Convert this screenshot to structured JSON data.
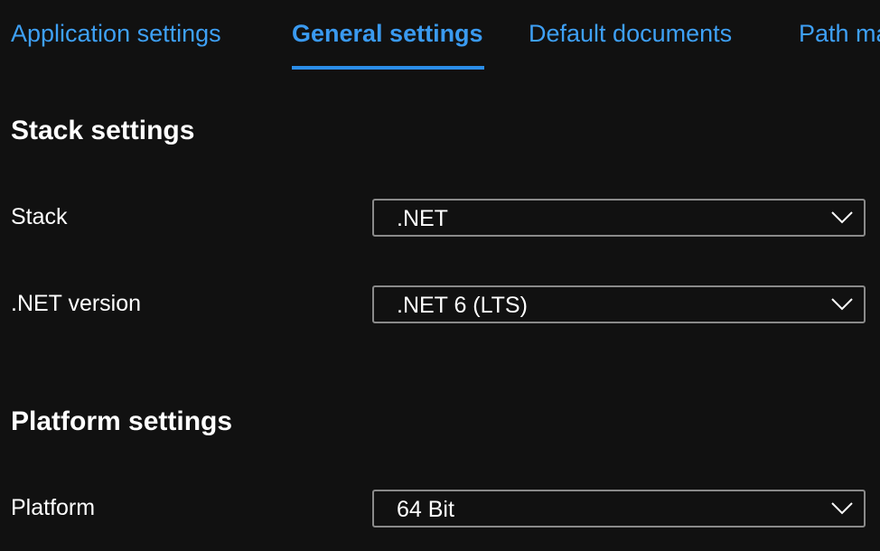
{
  "tabs": [
    {
      "label": "Application settings",
      "active": false
    },
    {
      "label": "General settings",
      "active": true
    },
    {
      "label": "Default documents",
      "active": false
    },
    {
      "label": "Path mappings",
      "active": false
    }
  ],
  "stack_settings": {
    "heading": "Stack settings",
    "stack": {
      "label": "Stack",
      "value": ".NET"
    },
    "net_version": {
      "label": ".NET version",
      "value": ".NET 6 (LTS)"
    }
  },
  "platform_settings": {
    "heading": "Platform settings",
    "platform": {
      "label": "Platform",
      "value": "64 Bit"
    }
  },
  "colors": {
    "background": "#111111",
    "accent": "#3a9af0",
    "text": "#ffffff",
    "border": "#8a8a8a"
  }
}
